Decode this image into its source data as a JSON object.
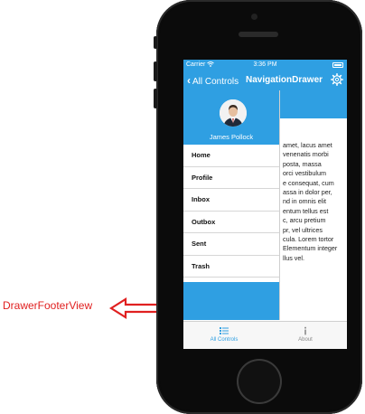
{
  "annotation": {
    "label": "DrawerFooterView",
    "color": "#e02020"
  },
  "status_bar": {
    "carrier": "Carrier",
    "time": "3:36 PM"
  },
  "nav_bar": {
    "back_label": "All Controls",
    "title": "NavigationDrawer",
    "settings_icon": "gear-icon"
  },
  "drawer": {
    "user_name": "James Pollock",
    "items": [
      {
        "label": "Home"
      },
      {
        "label": "Profile"
      },
      {
        "label": "Inbox"
      },
      {
        "label": "Outbox"
      },
      {
        "label": "Sent"
      },
      {
        "label": "Trash"
      }
    ]
  },
  "main_content": {
    "lines": [
      "amet, lacus amet",
      "venenatis morbi",
      "posta, massa",
      "orci vestibulum",
      "e consequat, cum",
      "assa in dolor per,",
      "nd in omnis elit",
      "entum tellus est",
      "c, arcu pretium",
      "pr, vel ultrices",
      "cula. Lorem tortor",
      "Elementum integer",
      "llus vel."
    ]
  },
  "tab_bar": {
    "tabs": [
      {
        "label": "All Controls",
        "icon": "list-icon"
      },
      {
        "label": "About",
        "icon": "info-icon"
      }
    ]
  },
  "colors": {
    "accent": "#2f9fe2",
    "annotation": "#e02020"
  }
}
